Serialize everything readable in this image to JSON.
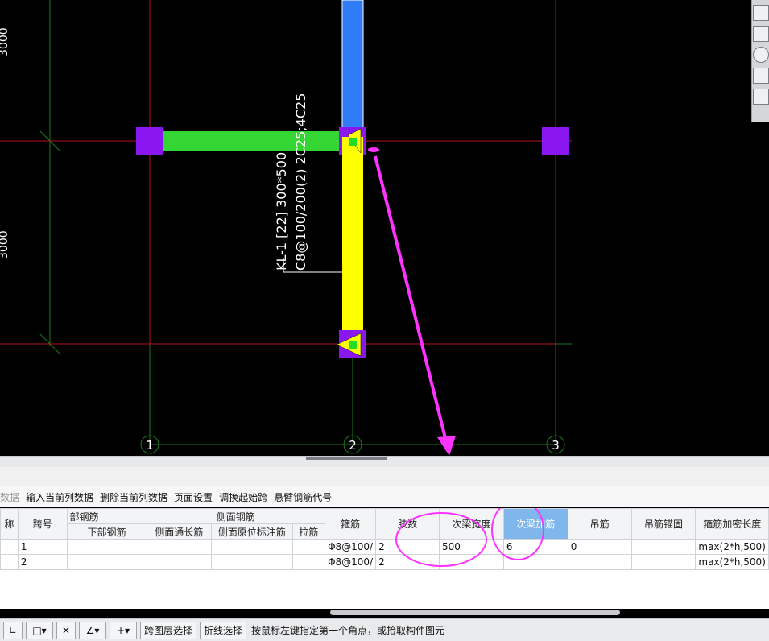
{
  "canvas": {
    "dim_labels": [
      "3000",
      "3000"
    ],
    "beam_annotation": {
      "line1": "KL-1 [22] 300*500",
      "line2": "C8@100/200(2) 2C25;4C25"
    },
    "axis_labels": [
      "1",
      "2",
      "3"
    ]
  },
  "grid_toolbar": {
    "items": [
      "数据",
      "输入当前列数据",
      "删除当前列数据",
      "页面设置",
      "调换起始跨",
      "悬臂钢筋代号"
    ]
  },
  "table": {
    "group_headers": {
      "name_col": "称",
      "span_no": "跨号",
      "bottom_rebar_group": "部钢筋",
      "side_rebar_group": "侧面钢筋"
    },
    "sub_headers": {
      "bottom_rebar": "下部钢筋",
      "side_through": "侧面通长筋",
      "side_original": "侧面原位标注筋",
      "tie": "拉筋"
    },
    "headers": [
      "箍筋",
      "肢数",
      "次梁宽度",
      "次梁加筋",
      "吊筋",
      "吊筋锚固",
      "箍筋加密长度"
    ],
    "rows": [
      {
        "span": "1",
        "stirrup": "Φ8@100/",
        "legs": "2",
        "sec_width": "500",
        "sec_add": "6",
        "hanger": "0",
        "hanger_anchor": "",
        "dense_len": "max(2*h,500)"
      },
      {
        "span": "2",
        "stirrup": "Φ8@100/",
        "legs": "2",
        "sec_width": "",
        "sec_add": "",
        "hanger": "",
        "hanger_anchor": "",
        "dense_len": "max(2*h,500)"
      }
    ]
  },
  "statusbar": {
    "btn_cross_layer": "跨图层选择",
    "btn_polyline": "折线选择",
    "hint": "按鼠标左键指定第一个角点，或拾取构件图元"
  },
  "colors": {
    "green_beam": "#33d633",
    "yellow_beam": "#ffff00",
    "blue_beam": "#2f7cf6",
    "column": "#8a17f0",
    "annotation": "#ff33ff",
    "active_header": "#7fb6ec"
  }
}
